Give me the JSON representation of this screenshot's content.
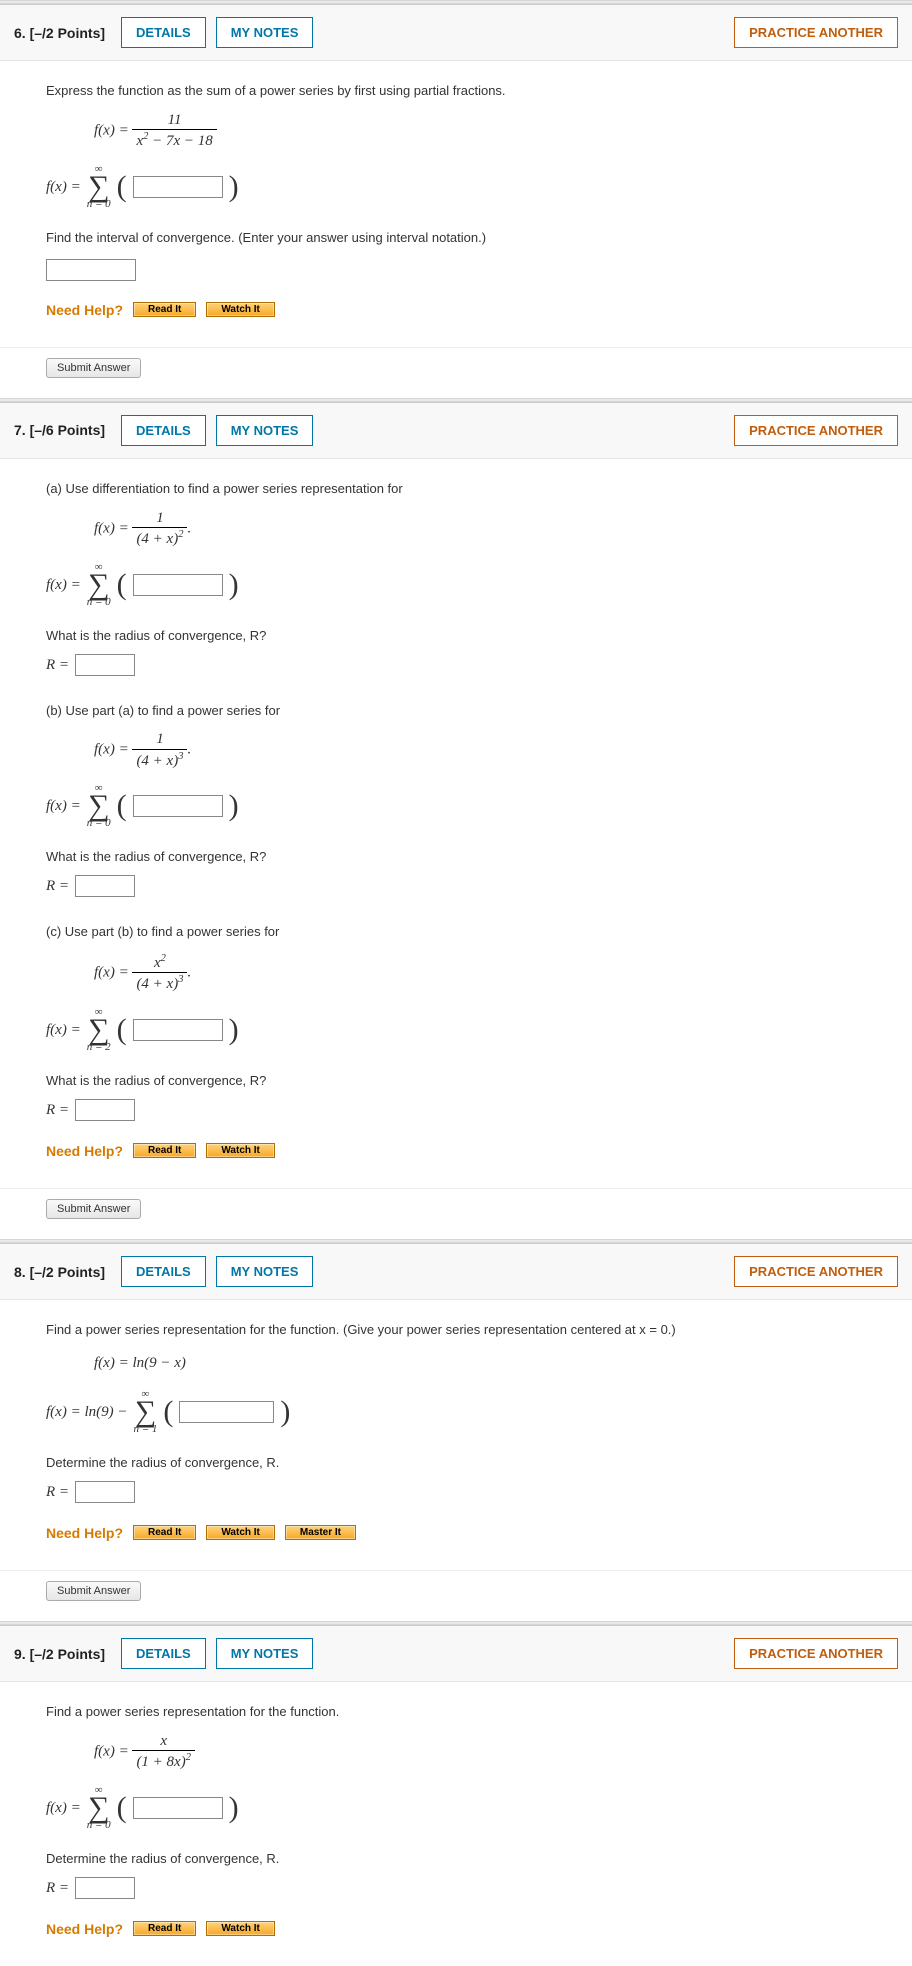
{
  "buttons": {
    "details": "DETAILS",
    "mynotes": "MY NOTES",
    "practice": "PRACTICE ANOTHER",
    "readit": "Read It",
    "watchit": "Watch It",
    "masterit": "Master It",
    "submit": "Submit Answer"
  },
  "needhelp": "Need Help?",
  "q6": {
    "num": "6.",
    "pts": "[–/2 Points]",
    "prompt": "Express the function as the sum of a power series by first using partial fractions.",
    "f_lhs": "f(x) = ",
    "f_num": "11",
    "f_den_a": "x",
    "f_den_b": " − 7x − 18",
    "sum_lhs": "f(x) = ",
    "sum_upper": "∞",
    "sum_lower": "n = 0",
    "interval_prompt": "Find the interval of convergence. (Enter your answer using interval notation.)"
  },
  "q7": {
    "num": "7.",
    "pts": "[–/6 Points]",
    "a_prompt": "(a) Use differentiation to find a power series representation for",
    "a_f_lhs": "f(x) = ",
    "a_num": "1",
    "a_den": "(4 + x)",
    "a_exp": "2",
    "sum_lhs": "f(x) = ",
    "sum_upper": "∞",
    "sum_lower0": "n = 0",
    "sum_lower2": "n = 2",
    "rad_prompt": "What is the radius of convergence, R?",
    "r_eq": "R = ",
    "b_prompt": "(b) Use part (a) to find a power series for",
    "b_num": "1",
    "b_den": "(4 + x)",
    "b_exp": "3",
    "c_prompt": "(c) Use part (b) to find a power series for",
    "c_num": "x",
    "c_num_exp": "2",
    "c_den": "(4 + x)",
    "c_exp": "3"
  },
  "q8": {
    "num": "8.",
    "pts": "[–/2 Points]",
    "prompt": "Find a power series representation for the function. (Give your power series representation centered at x = 0.)",
    "f_def": "f(x) = ln(9 − x)",
    "sum_lhs": "f(x) = ln(9) − ",
    "sum_upper": "∞",
    "sum_lower": "n = 1",
    "rad_prompt": "Determine the radius of convergence, R.",
    "r_eq": "R = "
  },
  "q9": {
    "num": "9.",
    "pts": "[–/2 Points]",
    "prompt": "Find a power series representation for the function.",
    "f_lhs": "f(x) = ",
    "f_num": "x",
    "f_den": "(1 + 8x)",
    "f_exp": "2",
    "sum_lhs": "f(x) = ",
    "sum_upper": "∞",
    "sum_lower": "n = 0",
    "rad_prompt": "Determine the radius of convergence, R.",
    "r_eq": "R = "
  }
}
